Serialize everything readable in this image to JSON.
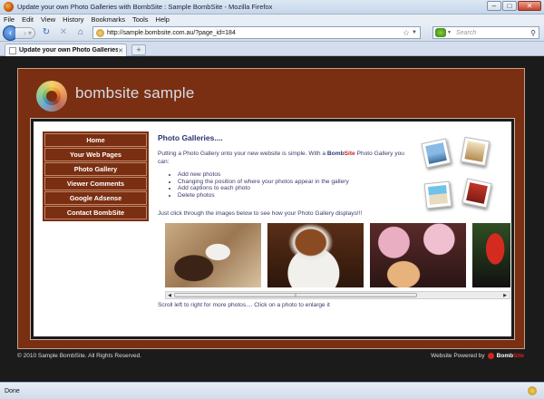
{
  "window": {
    "title": "Update your own Photo Galleries with BombSite : Sample BombSite - Mozilla Firefox"
  },
  "menubar": {
    "items": [
      "File",
      "Edit",
      "View",
      "History",
      "Bookmarks",
      "Tools",
      "Help"
    ]
  },
  "navbar": {
    "url": "http://sample.bombsite.com.au/?page_id=184",
    "search_placeholder": "Search"
  },
  "tabs": [
    {
      "label": "Update your own Photo Galleries wit..."
    }
  ],
  "site": {
    "name": "bombsite sample",
    "nav": [
      "Home",
      "Your Web Pages",
      "Photo Gallery",
      "Viewer Comments",
      "Google Adsense",
      "Contact BombSite"
    ],
    "page_title": "Photo Galleries....",
    "intro_before": "Putting a Photo Gallery onto your new website is simple. With a ",
    "intro_brand_a": "Bomb",
    "intro_brand_b": "Site",
    "intro_after": " Photo Gallery you can:",
    "features": [
      "Add new photos",
      "Changing the position of where your photos appear in the gallery",
      "Add captions to each photo",
      "Delete photos"
    ],
    "instruction": "Just click through the images below to see how your Photo Gallery displays!!!",
    "caption": "Scroll left to right for more photos.... Click on a photo to enlarge it",
    "footer_left": "© 2010 Sample BombSite. All Rights Reserved.",
    "footer_right": "Website Powered by",
    "footer_brand_a": "Bomb",
    "footer_brand_b": "Site"
  },
  "status": {
    "text": "Done"
  }
}
